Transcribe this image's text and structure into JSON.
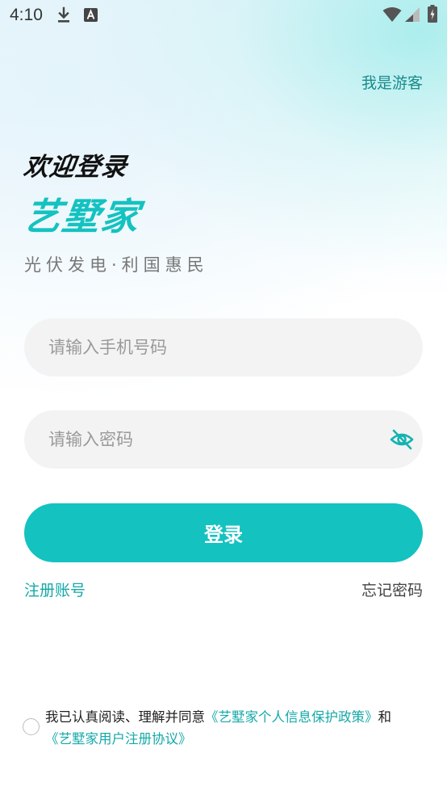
{
  "status_bar": {
    "time": "4:10",
    "icons": [
      "download-icon",
      "a-notification-icon",
      "wifi-icon",
      "signal-icon",
      "battery-icon"
    ]
  },
  "header": {
    "guest_label": "我是游客"
  },
  "hero": {
    "welcome": "欢迎登录",
    "brand": "艺墅家",
    "slogan": "光伏发电·利国惠民"
  },
  "form": {
    "phone_placeholder": "请输入手机号码",
    "phone_value": "",
    "password_placeholder": "请输入密码",
    "password_value": "",
    "password_toggle_icon": "eye-off-icon",
    "login_label": "登录"
  },
  "links": {
    "register": "注册账号",
    "forgot": "忘记密码"
  },
  "agreement": {
    "checked": false,
    "prefix": "我已认真阅读、理解并同意",
    "privacy_policy": "《艺墅家个人信息保护政策》",
    "connector": "和",
    "user_agreement": "《艺墅家用户注册协议》"
  },
  "colors": {
    "accent": "#14c2c0",
    "link": "#14a9a7",
    "guest_link": "#1a8c8a",
    "field_bg": "#f3f3f3"
  }
}
